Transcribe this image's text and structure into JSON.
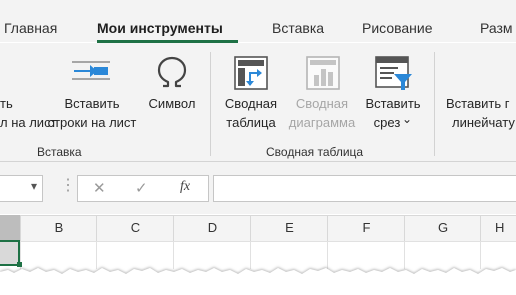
{
  "tabs": [
    {
      "label": "Главная"
    },
    {
      "label": "Мои инструменты",
      "active": true
    },
    {
      "label": "Вставка"
    },
    {
      "label": "Рисование"
    },
    {
      "label": "Разм"
    }
  ],
  "ribbon": {
    "cut_left": {
      "line1": "ть",
      "line2": "л на лист"
    },
    "insert_rows": {
      "line1": "Вставить",
      "line2": "строки на лист"
    },
    "symbol": {
      "line1": "Символ"
    },
    "pivot_table": {
      "line1": "Сводная",
      "line2": "таблица"
    },
    "pivot_chart": {
      "line1": "Сводная",
      "line2": "диаграмма",
      "disabled": true
    },
    "slicer": {
      "line1": "Вставить",
      "line2": "срез",
      "chevron": "⌄"
    },
    "insert_lined": {
      "line1": "Вставить г",
      "line2": "линейчату"
    },
    "groups": {
      "insert": "Вставка",
      "pivot": "Сводная таблица"
    }
  },
  "formula_bar": {
    "cancel_symbol": "✕",
    "enter_symbol": "✓",
    "fx_symbol": "fx",
    "dots": "⋮",
    "dropdown_symbol": "▾"
  },
  "columns": [
    "B",
    "C",
    "D",
    "E",
    "F",
    "G",
    "H"
  ],
  "icons": {
    "insert_rows": "insert-rows-icon",
    "symbol": "omega-icon",
    "pivot_table": "pivot-table-icon",
    "pivot_chart": "pivot-chart-icon",
    "slicer": "slicer-icon"
  },
  "colors": {
    "accent": "#1e7145",
    "ribbon_bg": "#f3f3f3",
    "icon_blue": "#2b88d8",
    "disabled": "#a6a6a6"
  }
}
